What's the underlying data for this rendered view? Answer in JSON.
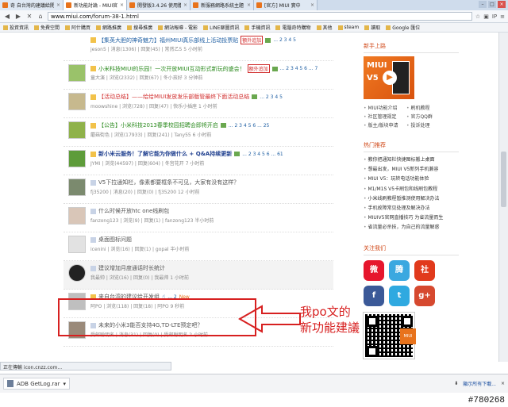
{
  "browser": {
    "tabs": [
      {
        "label": "奇 自台灣的建議給開發組",
        "active": false
      },
      {
        "label": "新功能討論 - MIUI官方",
        "active": true
      },
      {
        "label": "開發版3.4.26 使用體會",
        "active": false
      },
      {
        "label": "新服務網路系統主題",
        "active": false
      },
      {
        "label": "[官方] MIUI 實中",
        "active": false
      }
    ],
    "url_host": "www.miui.com",
    "url_path": "/forum-38-1.html",
    "bookmarks": [
      "投資資訊",
      "免費空間",
      "阿什購買",
      "網路推廣",
      "搜尋推廣",
      "網站報導 - 電影",
      "LINE聊圖資訊",
      "手機資訊",
      "電腦奇特購物",
      "其他",
      "steam",
      "讀取",
      "Google 匯位"
    ],
    "status_text": "正在傳輸 icon.cnzz.com...",
    "download_file": "ADB GetLog.rar",
    "show_all_downloads": "顯示所有下載..."
  },
  "threads": [
    {
      "title": "【集英大胆的神奇魅力】福州MIUI真乐部线上活动投票贴",
      "title_color": "normal",
      "tag": "额外追加",
      "pages": "... 2 3 4 5",
      "new": "",
      "meta": "jeson5 | 消息(1306) | 回复(45) | 常然乙5 5 小时前"
    },
    {
      "title": "小米科技MIUI的乐园！一次开放MIUI互动形式新玩的盛会！",
      "title_color": "green",
      "tag": "额外追加",
      "pages": "... 2 3 4 5 6 ... 7",
      "new": "",
      "meta": "童大演 | 浏览(2332) | 回复(67) | 冬小孩好 3 分钟前"
    },
    {
      "title": "【活动总结】——给给MIUI发放发乐部版管最终下面活动总结",
      "title_color": "red",
      "tag": "",
      "pages": "... 2 3 4 5",
      "new": "",
      "meta": "moowshine | 浏览(728) | 回复(47) | 快乐小插座 1 小时前"
    },
    {
      "title": "【公告】小米科技2013春季校园招聘会即将开启",
      "title_color": "green",
      "tag": "",
      "pages": "... 2 3 4 5 6 ... 25",
      "new": "",
      "meta": "蘑菇街色 | 浏览(17933) | 回复(241) | Tany55 6 小时前"
    },
    {
      "title": "新小米云服务！了解它能为你做什么 + Q&A持续更新",
      "title_color": "blue",
      "tag": "",
      "pages": "... 2 3 4 5 6 ... 61",
      "new": "",
      "meta": "JYMI | 浏览(44597) | 回复(604) | 冬宫花开 7 小时前"
    },
    {
      "title": "V5下拉通知栏，像素都要框条不可见，大家有没有这样？",
      "title_color": "normal",
      "tag": "",
      "pages": "",
      "new": "",
      "meta": "fj35200 | 消息(20) | 回复(0) | fj35200 12 小时前"
    },
    {
      "title": "什么时候开放htc one线刷包",
      "title_color": "normal",
      "tag": "",
      "pages": "",
      "new": "",
      "meta": "fanzong123 | 浏览(9) | 回复(1) | fanzong123 半小时前"
    },
    {
      "title": "桌面图标问题",
      "title_color": "normal",
      "tag": "",
      "pages": "",
      "new": "",
      "meta": "icenini | 浏览(16) | 回复(1) | gopal 半小时前"
    },
    {
      "title": "建议增加月度通话时长统计",
      "title_color": "normal",
      "tag": "",
      "pages": "",
      "new": "",
      "meta": "我最帅 | 浏览(16) | 回复(0) | 我最帅 1 小时前"
    },
    {
      "title": "来自台湾的建议给开发组",
      "title_color": "normal",
      "tag": "",
      "pages": "... 2",
      "new": "New",
      "meta": "阿PO | 浏览(118) | 回复(18) | 阿PO 9 秒前"
    },
    {
      "title": "未来的小米3能否支持4G,TD-LTE预定吧？",
      "title_color": "normal",
      "tag": "",
      "pages": "",
      "new": "",
      "meta": "受邮聪明名 | 消息(31) | 回复(0) | 受邮聪明名 2 小时前"
    }
  ],
  "sidebar": {
    "newbie_head": "新手上路",
    "ad_title": "MIUI",
    "ad_version": "V5",
    "newbie_links": [
      "MIUI功能介绍",
      "刷机教程",
      "社区管理规定",
      "官方QQ群",
      "版主/版块申请",
      "投诉处理"
    ],
    "hot_head": "热门推荐",
    "hot_links": [
      "教你把通知栏快捷图标搬上桌面",
      "想最出发，MIUI V5新列手机兼容",
      "MIUI V5：玩转电话功能体验",
      "M1/M1S V5卡刷包和线刷包教程",
      "小米线刷教程暂推测使用解决办法",
      "手机故障常见处理及解决办法",
      "MIUIV5官网直播技巧 为省流量而生",
      "省流量必杀技，为自己的流量解惑"
    ],
    "follow_head": "关注我们",
    "social": [
      {
        "name": "weibo-icon",
        "label": "微",
        "color": "#e6162d"
      },
      {
        "name": "tencent-weibo-icon",
        "label": "腾",
        "color": "#3aa8e0"
      },
      {
        "name": "community-icon",
        "label": "社",
        "color": "#e13a1c"
      },
      {
        "name": "facebook-icon",
        "label": "f",
        "color": "#3b5998"
      },
      {
        "name": "twitter-icon",
        "label": "t",
        "color": "#2fa9e0"
      },
      {
        "name": "google-plus-icon",
        "label": "g+",
        "color": "#d6492f"
      }
    ]
  },
  "annotation": {
    "line1": "我po文的",
    "line2": "新功能建議",
    "color": "#d72020"
  },
  "watermark": "#780268"
}
